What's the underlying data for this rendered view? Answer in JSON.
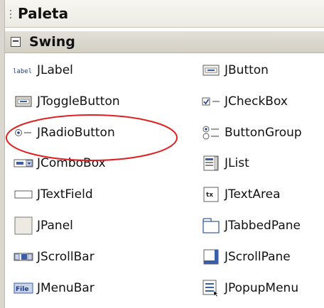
{
  "palette": {
    "title": "Paleta"
  },
  "category": {
    "label": "Swing",
    "toggle_glyph": "−"
  },
  "items": {
    "jlabel": "JLabel",
    "jbutton": "JButton",
    "jtogglebutton": "JToggleButton",
    "jcheckbox": "JCheckBox",
    "jradiobutton": "JRadioButton",
    "buttongroup": "ButtonGroup",
    "jcombobox": "JComboBox",
    "jlist": "JList",
    "jtextfield": "JTextField",
    "jtextarea": "JTextArea",
    "jpanel": "JPanel",
    "jtabbedpane": "JTabbedPane",
    "jscrollbar": "JScrollBar",
    "jscrollpane": "JScrollPane",
    "jmenubar": "JMenuBar",
    "jpopupmenu": "JPopupMenu"
  },
  "icon_text": {
    "jlabel": "label",
    "jtextarea": "tx",
    "jmenubar": "File"
  },
  "colors": {
    "highlight_ellipse": "#e02020",
    "icon_blue": "#3a5fa8"
  }
}
